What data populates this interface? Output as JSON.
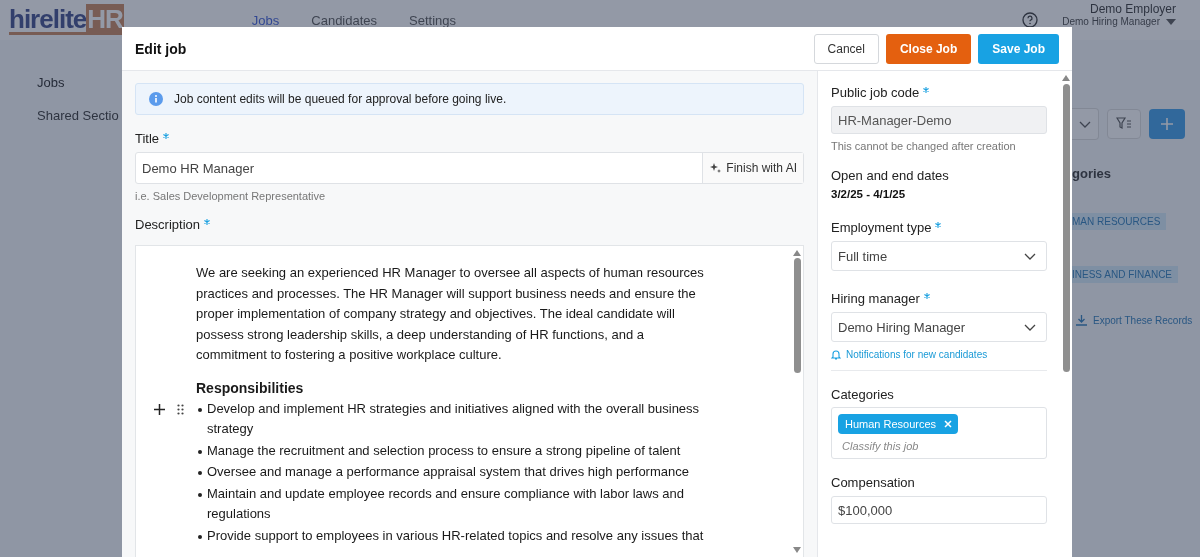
{
  "app": {
    "logo": {
      "name": "hirelite",
      "accent": "HR"
    },
    "nav": [
      {
        "label": "Jobs",
        "selected": true
      },
      {
        "label": "Candidates",
        "selected": false
      },
      {
        "label": "Settings",
        "selected": false
      }
    ],
    "user": {
      "name": "Demo Employer",
      "role": "Demo Hiring Manager"
    }
  },
  "background": {
    "sidebar": [
      "Jobs",
      "Shared Sectio"
    ],
    "categories_heading": "gories",
    "categories": [
      "MAN RESOURCES",
      "INESS AND FINANCE"
    ],
    "export_link": "Export These Records"
  },
  "modal": {
    "title": "Edit job",
    "buttons": [
      {
        "label": "Cancel",
        "kind": "secondary"
      },
      {
        "label": "Close Job",
        "kind": "danger"
      },
      {
        "label": "Save Job",
        "kind": "primary"
      }
    ],
    "notice": "Job content edits will be queued for approval before going live.",
    "title_field": {
      "label": "Title",
      "required": true,
      "value": "Demo HR Manager",
      "ai_button": "Finish with AI",
      "hint": "i.e. Sales Development Representative"
    },
    "description": {
      "label": "Description",
      "required": true,
      "intro": "We are seeking an experienced HR Manager to oversee all aspects of human resources practices and processes. The HR Manager will support business needs and ensure the proper implementation of company strategy and objectives. The ideal candidate will possess strong leadership skills, a deep understanding of HR functions, and a commitment to fostering a positive workplace culture.",
      "heading": "Responsibilities",
      "items": [
        "Develop and implement HR strategies and initiatives aligned with the overall business strategy",
        "Manage the recruitment and selection process to ensure a strong pipeline of talent",
        "Oversee and manage a performance appraisal system that drives high performance",
        "Maintain and update employee records and ensure compliance with labor laws and regulations",
        "Provide support to employees in various HR-related topics and resolve any issues that"
      ]
    },
    "job_code": {
      "label": "Public job code",
      "required": true,
      "value": "HR-Manager-Demo",
      "disabled": true,
      "hint": "This cannot be changed after creation"
    },
    "dates": {
      "label": "Open and end dates",
      "value": "3/2/25 - 4/1/25"
    },
    "employment_type": {
      "label": "Employment type",
      "required": true,
      "value": "Full time"
    },
    "hiring_manager": {
      "label": "Hiring manager",
      "required": true,
      "value": "Demo Hiring Manager",
      "link": "Notifications for new candidates"
    },
    "categories": {
      "label": "Categories",
      "tags": [
        "Human Resources"
      ],
      "placeholder": "Classify this job"
    },
    "compensation": {
      "label": "Compensation",
      "value": "$100,000"
    }
  }
}
